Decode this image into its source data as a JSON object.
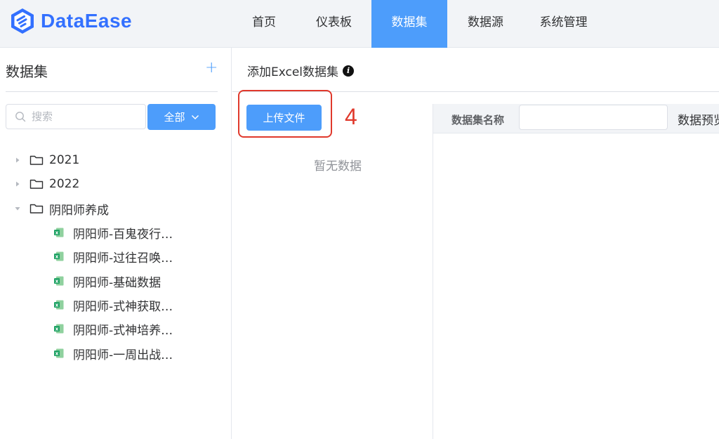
{
  "app": {
    "logo_text": "DataEase",
    "accent": "#4d9dfb",
    "brand": "#3370ff"
  },
  "nav": [
    {
      "label": "首页",
      "active": false
    },
    {
      "label": "仪表板",
      "active": false
    },
    {
      "label": "数据集",
      "active": true
    },
    {
      "label": "数据源",
      "active": false
    },
    {
      "label": "系统管理",
      "active": false
    }
  ],
  "sidebar": {
    "title": "数据集",
    "add_icon": "plus-icon",
    "search": {
      "placeholder": "搜索",
      "value": ""
    },
    "filter_label": "全部",
    "tree": [
      {
        "label": "2021",
        "type": "folder",
        "expanded": false
      },
      {
        "label": "2022",
        "type": "folder",
        "expanded": false
      },
      {
        "label": "阴阳师养成",
        "type": "folder",
        "expanded": true
      },
      {
        "label": "阴阳师-百鬼夜行…",
        "type": "excel"
      },
      {
        "label": "阴阳师-过往召唤…",
        "type": "excel"
      },
      {
        "label": "阴阳师-基础数据",
        "type": "excel"
      },
      {
        "label": "阴阳师-式神获取…",
        "type": "excel"
      },
      {
        "label": "阴阳师-式神培养…",
        "type": "excel"
      },
      {
        "label": "阴阳师-一周出战…",
        "type": "excel"
      }
    ]
  },
  "main": {
    "title": "添加Excel数据集",
    "upload_label": "上传文件",
    "annotation_step": "4",
    "empty_text": "暂无数据",
    "dataset_name_label": "数据集名称",
    "dataset_name_value": "",
    "preview_label": "数据预览"
  }
}
